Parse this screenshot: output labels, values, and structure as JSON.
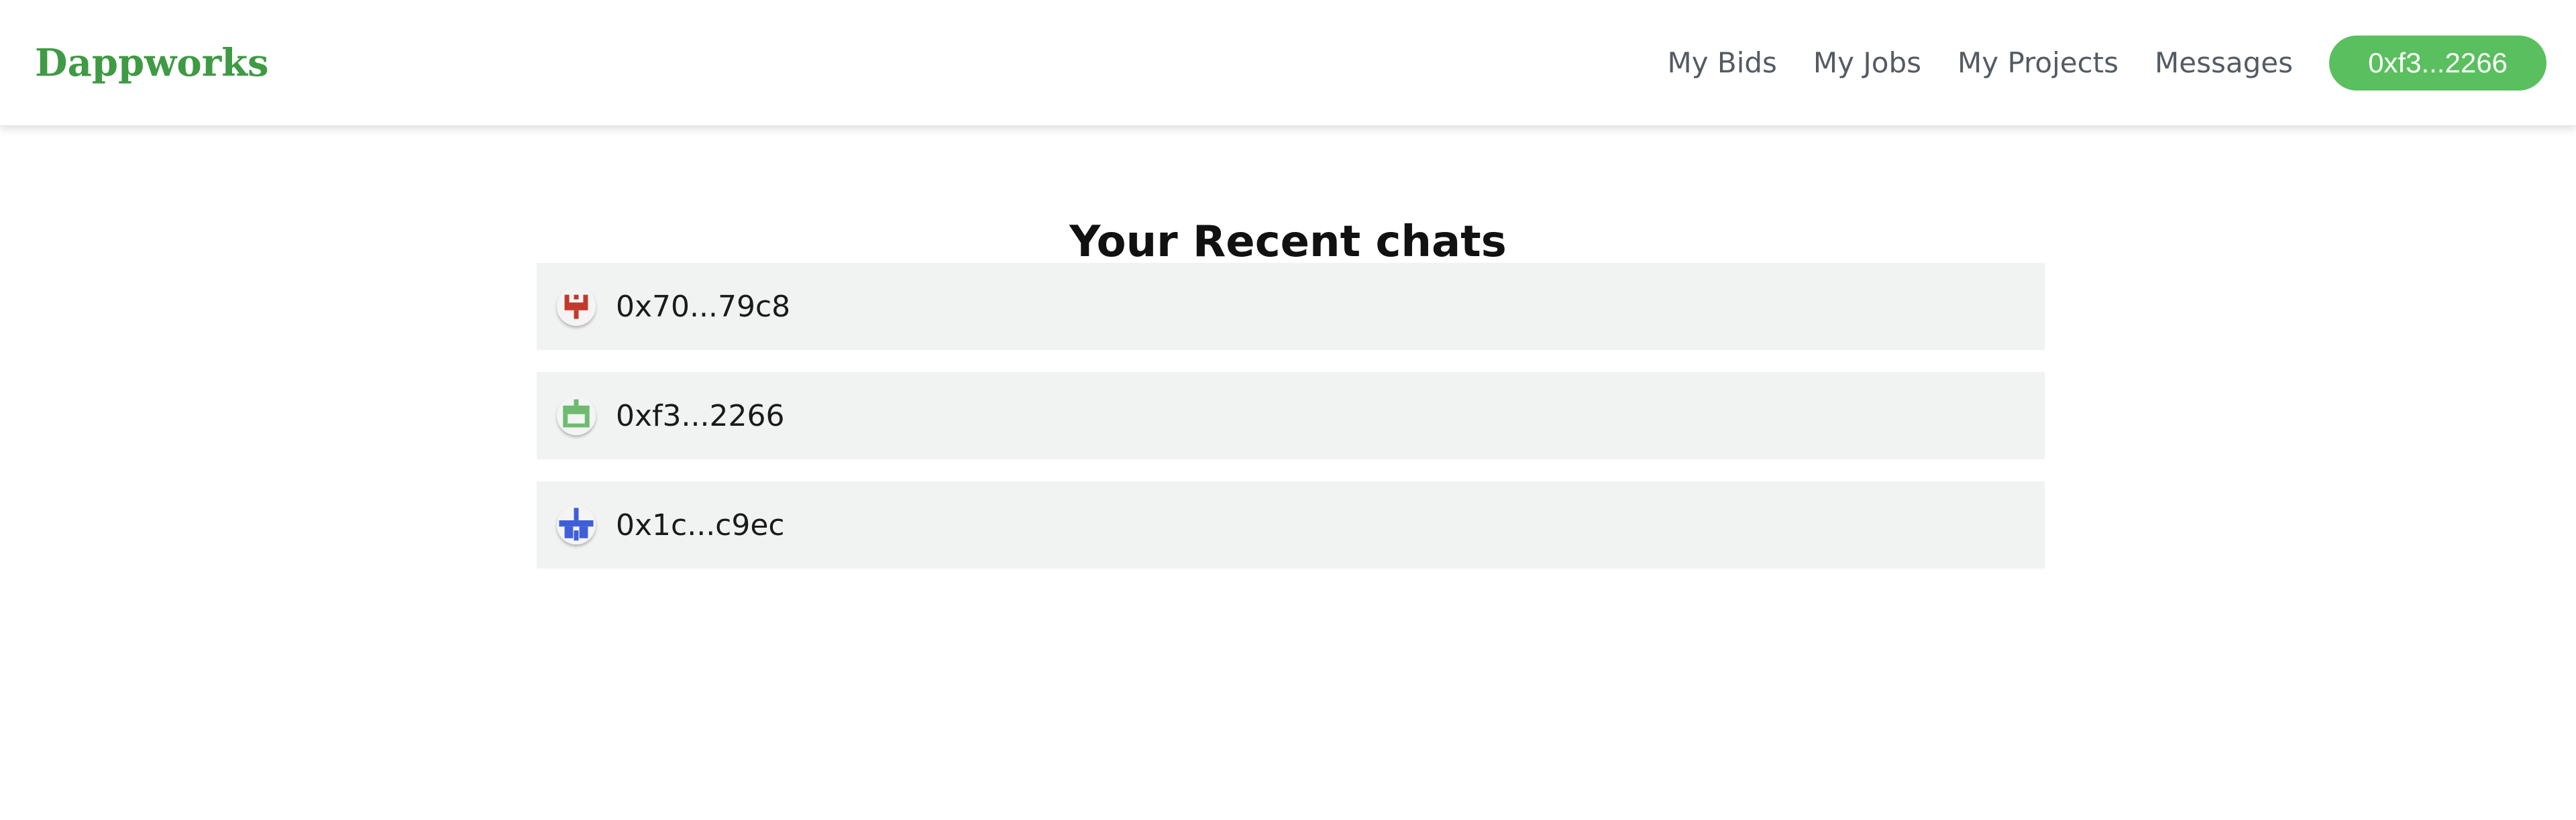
{
  "header": {
    "brand": "Dappworks",
    "nav": {
      "my_bids": "My Bids",
      "my_jobs": "My Jobs",
      "my_projects": "My Projects",
      "messages": "Messages"
    },
    "account_label": "0xf3...2266"
  },
  "main": {
    "title": "Your Recent chats",
    "chats": [
      {
        "address": "0x70...79c8",
        "avatar_color": "#c0392b",
        "avatar_icon": "identicon-red"
      },
      {
        "address": "0xf3...2266",
        "avatar_color": "#6dbb6e",
        "avatar_icon": "identicon-green"
      },
      {
        "address": "0x1c...c9ec",
        "avatar_color": "#3f5fd8",
        "avatar_icon": "identicon-blue"
      }
    ]
  },
  "colors": {
    "brand": "#3f9a44",
    "accent_button": "#5abf5e",
    "chat_row_background": "#f1f2f2"
  }
}
